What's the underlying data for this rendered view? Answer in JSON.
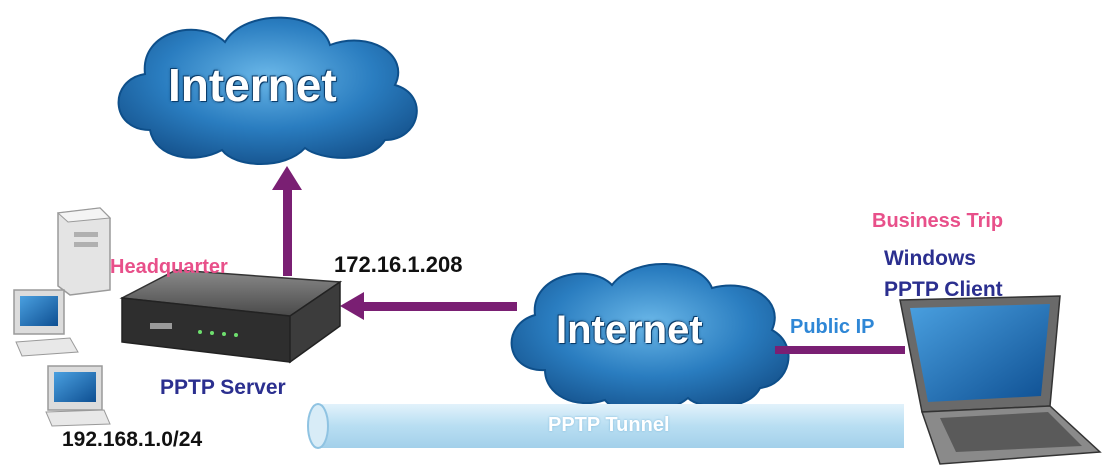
{
  "clouds": {
    "top": {
      "label": "Internet"
    },
    "middle": {
      "label": "Internet"
    }
  },
  "labels": {
    "headquarter": "Headquarter",
    "server_ip": "172.16.1.208",
    "pptp_server": "PPTP Server",
    "lan_subnet": "192.168.1.0/24",
    "business_trip": "Business Trip",
    "client_line1": "Windows",
    "client_line2": "PPTP Client",
    "public_ip": "Public IP",
    "tunnel": "PPTP Tunnel"
  },
  "colors": {
    "arrow": "#7a1f73",
    "cloud": "#1f72b8",
    "pink_label": "#e8508a",
    "navy_label": "#2b2f8f",
    "tunnel": "#bfe0f2",
    "public_ip": "#2f87d6"
  }
}
